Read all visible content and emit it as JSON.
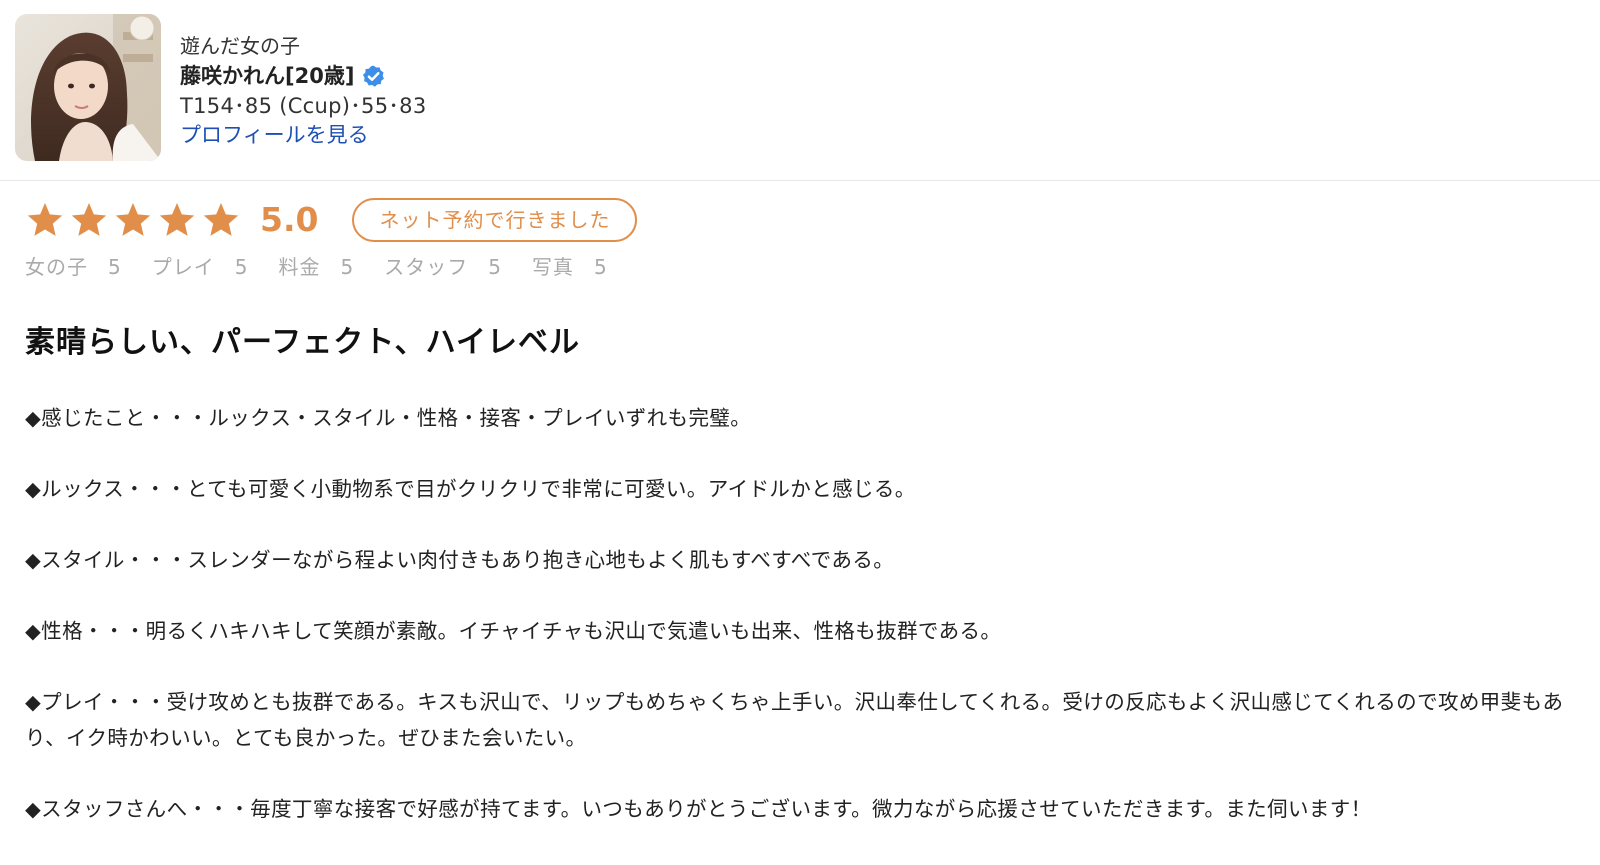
{
  "header": {
    "played_label": "遊んだ女の子",
    "girl_name": "藤咲かれん[20歳]",
    "specs": "T154･85 (Ccup)･55･83",
    "profile_link": "プロフィールを見る"
  },
  "rating": {
    "stars": 5,
    "score": "5.0",
    "badge": "ネット予約で行きました",
    "subscores": [
      {
        "label": "女の子",
        "value": "5"
      },
      {
        "label": "プレイ",
        "value": "5"
      },
      {
        "label": "料金",
        "value": "5"
      },
      {
        "label": "スタッフ",
        "value": "5"
      },
      {
        "label": "写真",
        "value": "5"
      }
    ]
  },
  "review": {
    "title": "素晴らしい、パーフェクト、ハイレベル",
    "paragraphs": [
      "◆感じたこと・・・ルックス・スタイル・性格・接客・プレイいずれも完璧。",
      "◆ルックス・・・とても可愛く小動物系で目がクリクリで非常に可愛い。アイドルかと感じる。",
      "◆スタイル・・・スレンダーながら程よい肉付きもあり抱き心地もよく肌もすべすべである。",
      "◆性格・・・明るくハキハキして笑顔が素敵。イチャイチャも沢山で気遣いも出来、性格も抜群である。",
      "◆プレイ・・・受け攻めとも抜群である。キスも沢山で、リップもめちゃくちゃ上手い。沢山奉仕してくれる。受けの反応もよく沢山感じてくれるので攻め甲斐もあり、イク時かわいい。とても良かった。ぜひまた会いたい。",
      "◆スタッフさんへ・・・毎度丁寧な接客で好感が持てます。いつもありがとうございます。微力ながら応援させていただきます。また伺います！"
    ]
  },
  "colors": {
    "accent": "#e08e4a",
    "link": "#1e4fb4",
    "verified": "#3d8ee8",
    "subscore_text": "#aaaaaa"
  },
  "icons": {
    "star": "star-icon",
    "verified": "verified-badge-icon"
  }
}
